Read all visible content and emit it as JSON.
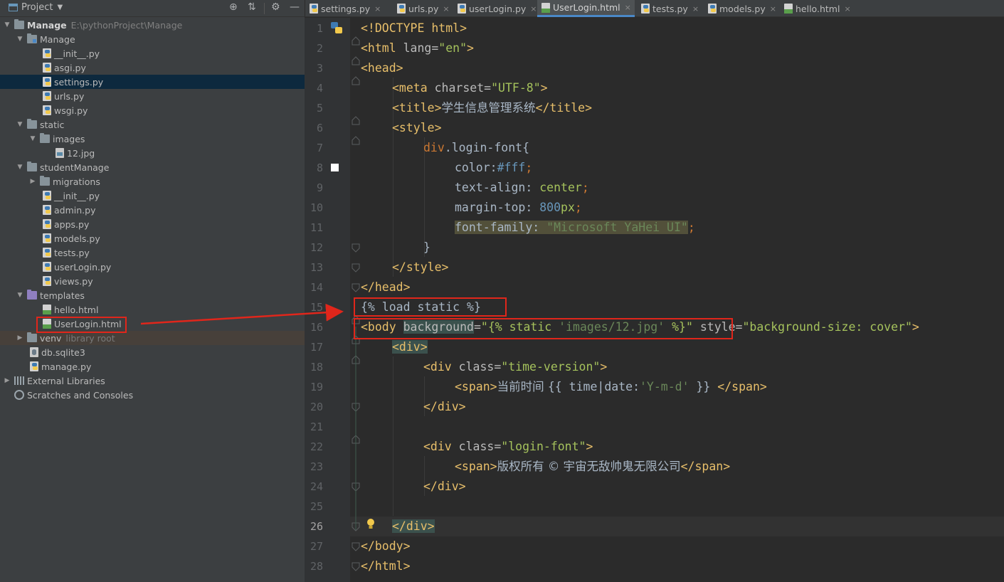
{
  "colors": {
    "annotation": "#e0261b",
    "accent": "#4a88c7",
    "tag": "#e8bf6a",
    "string": "#a5c25c",
    "keyword": "#cc7832",
    "number": "#6897bb"
  },
  "project_panel": {
    "title": "Project",
    "tools": [
      "target-icon",
      "collapse-icon",
      "gear-icon",
      "minimize-icon"
    ],
    "tree": [
      {
        "label": "Manage",
        "path": "E:\\pythonProject\\Manage",
        "icon": "folder-icon"
      },
      {
        "label": "Manage",
        "icon": "folder-icon"
      },
      {
        "label": "__init__.py",
        "icon": "python-file-icon"
      },
      {
        "label": "asgi.py",
        "icon": "python-file-icon"
      },
      {
        "label": "settings.py",
        "icon": "python-file-icon"
      },
      {
        "label": "urls.py",
        "icon": "python-file-icon"
      },
      {
        "label": "wsgi.py",
        "icon": "python-file-icon"
      },
      {
        "label": "static",
        "icon": "folder-icon"
      },
      {
        "label": "images",
        "icon": "folder-icon"
      },
      {
        "label": "12.jpg",
        "icon": "image-file-icon"
      },
      {
        "label": "studentManage",
        "icon": "folder-icon"
      },
      {
        "label": "migrations",
        "icon": "folder-icon"
      },
      {
        "label": "__init__.py",
        "icon": "python-file-icon"
      },
      {
        "label": "admin.py",
        "icon": "python-file-icon"
      },
      {
        "label": "apps.py",
        "icon": "python-file-icon"
      },
      {
        "label": "models.py",
        "icon": "python-file-icon"
      },
      {
        "label": "tests.py",
        "icon": "python-file-icon"
      },
      {
        "label": "userLogin.py",
        "icon": "python-file-icon"
      },
      {
        "label": "views.py",
        "icon": "python-file-icon"
      },
      {
        "label": "templates",
        "icon": "template-folder-icon"
      },
      {
        "label": "hello.html",
        "icon": "html-file-icon"
      },
      {
        "label": "UserLogin.html",
        "icon": "html-file-icon"
      },
      {
        "label": "venv",
        "note": "library root",
        "icon": "folder-icon"
      },
      {
        "label": "db.sqlite3",
        "icon": "database-file-icon"
      },
      {
        "label": "manage.py",
        "icon": "python-file-icon"
      },
      {
        "label": "External Libraries",
        "icon": "library-icon"
      },
      {
        "label": "Scratches and Consoles",
        "icon": "scratch-icon"
      }
    ]
  },
  "tabs": [
    {
      "label": "settings.py",
      "icon": "python-file-icon"
    },
    {
      "label": "urls.py",
      "icon": "python-file-icon"
    },
    {
      "label": "userLogin.py",
      "icon": "python-file-icon"
    },
    {
      "label": "UserLogin.html",
      "icon": "html-file-icon",
      "active": true
    },
    {
      "label": "tests.py",
      "icon": "python-file-icon"
    },
    {
      "label": "models.py",
      "icon": "python-file-icon"
    },
    {
      "label": "hello.html",
      "icon": "html-file-icon"
    }
  ],
  "tab_close": "×",
  "editor": {
    "current_line": "26",
    "line_numbers": [
      "1",
      "2",
      "3",
      "4",
      "5",
      "6",
      "7",
      "8",
      "9",
      "10",
      "11",
      "12",
      "13",
      "14",
      "15",
      "16",
      "17",
      "18",
      "19",
      "20",
      "21",
      "22",
      "23",
      "24",
      "25",
      "26",
      "27",
      "28"
    ],
    "code": {
      "l1": {
        "a": "<!DOCTYPE ",
        "b": "html",
        "c": ">"
      },
      "l2": {
        "a": "<html ",
        "b": "lang",
        "c": "=",
        "d": "\"en\"",
        "e": ">"
      },
      "l3": {
        "a": "<head>"
      },
      "l4": {
        "a": "<meta ",
        "b": "charset",
        "c": "=",
        "d": "\"UTF-8\"",
        "e": ">"
      },
      "l5": {
        "a": "<title>",
        "b": "学生信息管理系统",
        "c": "</title>"
      },
      "l6": {
        "a": "<style>"
      },
      "l7": {
        "a": "div",
        "b": ".login-font{"
      },
      "l8": {
        "a": "color:",
        "b": "#fff",
        "c": ";"
      },
      "l9": {
        "a": "text-align: ",
        "b": "center",
        "c": ";"
      },
      "l10": {
        "a": "margin-top: ",
        "b": "800",
        "c": "px",
        "d": ";"
      },
      "l11": {
        "a": "font-family: ",
        "b": "\"Microsoft YaHei UI\"",
        "c": ";"
      },
      "l12": {
        "a": "}"
      },
      "l13": {
        "a": "</style>"
      },
      "l14": {
        "a": "</head>"
      },
      "l15": {
        "a": "{% load static %}"
      },
      "l16": {
        "a": "<body ",
        "b": "background",
        "c": "=",
        "d": "\"{% static ",
        "e": "'images/12.jpg'",
        "f": " %}\"",
        "g": " style",
        "h": "=",
        "i": "\"background-size: ",
        "j": "cover",
        "k": "\"",
        "l": ">"
      },
      "l17": {
        "a": "<div>"
      },
      "l18": {
        "a": "<div ",
        "b": "class",
        "c": "=",
        "d": "\"time-version\"",
        "e": ">"
      },
      "l19": {
        "a": "<span>",
        "b": "当前时间 ",
        "c": "{{ time|date:",
        "d": "'Y-m-d'",
        "e": " }} ",
        "f": "</span>"
      },
      "l20": {
        "a": "</div>"
      },
      "l22": {
        "a": "<div ",
        "b": "class",
        "c": "=",
        "d": "\"login-font\"",
        "e": ">"
      },
      "l23": {
        "a": "<span>",
        "b": "版权所有 © 宇宙无敌帅鬼无限公司",
        "c": "</span>"
      },
      "l24": {
        "a": "</div>"
      },
      "l26": {
        "a": "</div>"
      },
      "l27": {
        "a": "</body>"
      },
      "l28": {
        "a": "</html>"
      }
    }
  }
}
